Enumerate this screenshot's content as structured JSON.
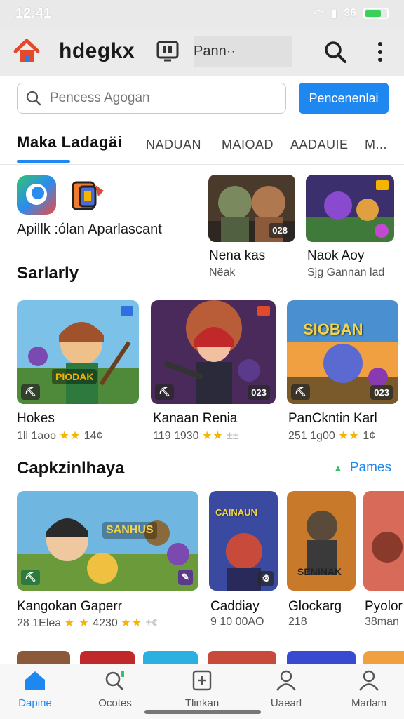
{
  "status": {
    "time": "12:41",
    "battery_text": "36"
  },
  "header": {
    "title": "hdegkx",
    "subtitle": "Pann··"
  },
  "search": {
    "placeholder": "Pencess Agogan",
    "button_label": "Pencenenlai"
  },
  "tabs": [
    {
      "label": "Maka Ladagäi",
      "active": true
    },
    {
      "label": "NADUAN"
    },
    {
      "label": "MAIOAD"
    },
    {
      "label": "AADAUIE"
    },
    {
      "label": "M..."
    }
  ],
  "apps_label": "Apillk :ólan Aparlascant",
  "featured": [
    {
      "title": "Nena kas",
      "meta": "Nëak",
      "badge": "028"
    },
    {
      "title": "Naok Aoy",
      "meta": "Sjg Gannan lad"
    }
  ],
  "section1": {
    "title": "Sarlarly",
    "cards": [
      {
        "title": "Hokes",
        "meta": "1ll 1aoo",
        "rating": "14¢",
        "banner": "PIODAK"
      },
      {
        "title": "Kanaan Renia",
        "meta": "119 1930",
        "rating": "±±",
        "badge": "023"
      },
      {
        "title": "PanCkntin Karl",
        "meta": "251 1g00",
        "rating": "1¢",
        "banner": "SIOBAN",
        "badge": "023"
      }
    ]
  },
  "section2": {
    "title": "Capkzinlhaya",
    "more_label": "Pames",
    "cards": [
      {
        "title": "Kangokan Gaperr",
        "meta": "28 1Elea",
        "meta2": "4230",
        "rating": "±¢",
        "banner": "SANHUS"
      },
      {
        "title": "Caddiay",
        "meta": "9 10 00AO",
        "banner": "CAINAUN"
      },
      {
        "title": "Glockarg",
        "meta": "218",
        "banner": "SENINAK"
      },
      {
        "title": "Pyolor",
        "meta": "38man"
      }
    ]
  },
  "nav": [
    {
      "label": "Dapine",
      "active": true
    },
    {
      "label": "Ocotes"
    },
    {
      "label": "Tlinkan"
    },
    {
      "label": "Uaearl"
    },
    {
      "label": "Marlam"
    }
  ],
  "colors": {
    "accent": "#1e88f0",
    "star": "#f4b400"
  }
}
